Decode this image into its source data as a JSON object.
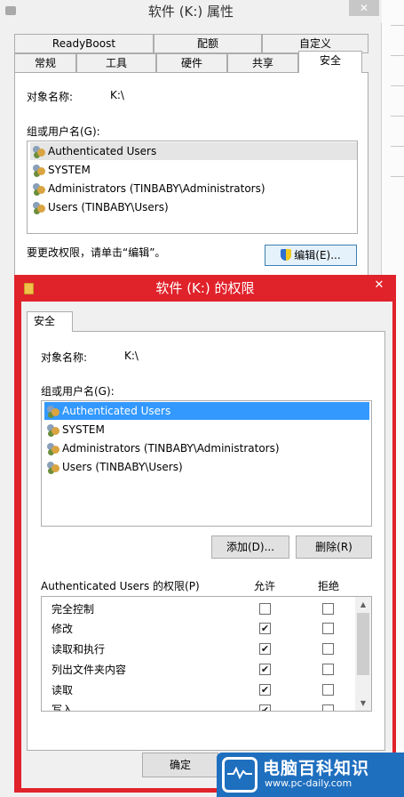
{
  "properties_window": {
    "title": "软件 (K:) 属性",
    "close_glyph": "✕",
    "tabs_row1": [
      "ReadyBoost",
      "配额",
      "自定义"
    ],
    "tabs_row2": [
      "常规",
      "工具",
      "硬件",
      "共享",
      "安全"
    ],
    "active_tab": "安全",
    "object_name_label": "对象名称:",
    "object_name_value": "K:\\",
    "group_label": "组或用户名(G):",
    "users": [
      "Authenticated Users",
      "SYSTEM",
      "Administrators (TINBABY\\Administrators)",
      "Users (TINBABY\\Users)"
    ],
    "change_hint": "要更改权限，请单击“编辑”。",
    "edit_button": "编辑(E)..."
  },
  "permissions_dialog": {
    "title": "软件 (K:) 的权限",
    "close_glyph": "✕",
    "tab": "安全",
    "object_name_label": "对象名称:",
    "object_name_value": "K:\\",
    "group_label": "组或用户名(G):",
    "users": [
      "Authenticated Users",
      "SYSTEM",
      "Administrators (TINBABY\\Administrators)",
      "Users (TINBABY\\Users)"
    ],
    "selected_user": "Authenticated Users",
    "add_button": "添加(D)...",
    "remove_button": "删除(R)",
    "permissions_label": "Authenticated Users 的权限(P)",
    "allow_header": "允许",
    "deny_header": "拒绝",
    "permissions": [
      {
        "name": "完全控制",
        "allow": false,
        "deny": false
      },
      {
        "name": "修改",
        "allow": true,
        "deny": false
      },
      {
        "name": "读取和执行",
        "allow": true,
        "deny": false
      },
      {
        "name": "列出文件夹内容",
        "allow": true,
        "deny": false
      },
      {
        "name": "读取",
        "allow": true,
        "deny": false
      },
      {
        "name": "写入",
        "allow": true,
        "deny": false
      }
    ],
    "ok_button": "确定"
  },
  "watermark": {
    "brand": "电脑百科知识",
    "url": "www.pc-daily.com",
    "color": "#1f6fbf"
  },
  "colors": {
    "dialog_frame": "#e0222a",
    "selection": "#3399ff"
  }
}
